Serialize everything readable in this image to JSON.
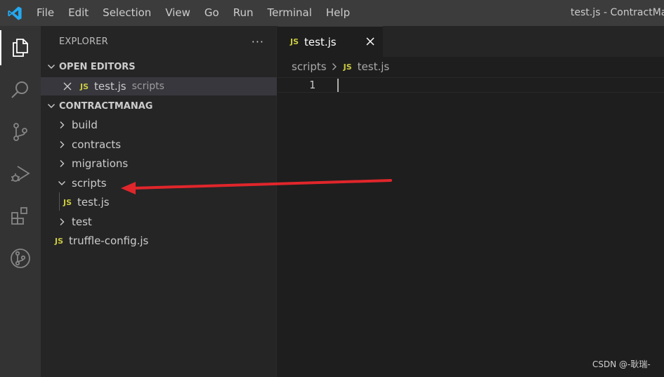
{
  "titlebar": {
    "logo_icon": "vscode-logo",
    "menu": [
      "File",
      "Edit",
      "Selection",
      "View",
      "Go",
      "Run",
      "Terminal",
      "Help"
    ],
    "window_title": "test.js - ContractMan"
  },
  "activitybar": {
    "items": [
      "explorer-icon",
      "search-icon",
      "source-control-icon",
      "run-debug-icon",
      "extensions-icon",
      "git-graph-icon"
    ],
    "active": "explorer-icon"
  },
  "sidebar": {
    "title": "EXPLORER",
    "more": "···",
    "open_editors": {
      "header": "OPEN EDITORS",
      "items": [
        {
          "badge": "JS",
          "name": "test.js",
          "folder": "scripts"
        }
      ]
    },
    "project": {
      "header": "CONTRACTMANAG",
      "tree": [
        {
          "type": "folder",
          "name": "build",
          "expanded": false
        },
        {
          "type": "folder",
          "name": "contracts",
          "expanded": false
        },
        {
          "type": "folder",
          "name": "migrations",
          "expanded": false
        },
        {
          "type": "folder",
          "name": "scripts",
          "expanded": true
        },
        {
          "type": "file",
          "badge": "JS",
          "name": "test.js"
        },
        {
          "type": "folder",
          "name": "test",
          "expanded": false
        },
        {
          "type": "file",
          "badge": "JS",
          "name": "truffle-config.js"
        }
      ]
    }
  },
  "editor": {
    "tab": {
      "badge": "JS",
      "name": "test.js"
    },
    "breadcrumb": {
      "folder": "scripts",
      "badge": "JS",
      "file": "test.js"
    },
    "line_number": "1"
  },
  "watermark": "CSDN @-耿瑞-",
  "colors": {
    "accent": "#0078d4",
    "js_yellow": "#cbcb41",
    "arrow_red": "#e0262b"
  }
}
